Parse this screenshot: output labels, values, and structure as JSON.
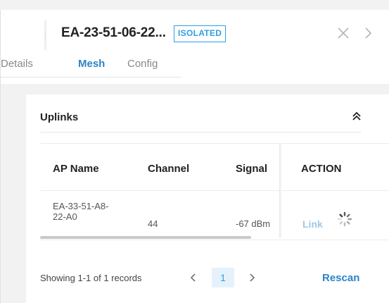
{
  "header": {
    "device_name": "EA-23-51-06-22...",
    "status_badge": "ISOLATED"
  },
  "tabs": [
    {
      "label": "Details",
      "active": false
    },
    {
      "label": "Mesh",
      "active": true
    },
    {
      "label": "Config",
      "active": false
    }
  ],
  "uplinks": {
    "title": "Uplinks",
    "columns": [
      "AP Name",
      "Channel",
      "Signal",
      "ACTION"
    ],
    "rows": [
      {
        "ap_name_line1": "EA-33-51-A8-",
        "ap_name_line2": "22-A0",
        "channel": "44",
        "signal": "-67 dBm",
        "action": "Link"
      }
    ],
    "records_text": "Showing 1-1 of 1 records",
    "current_page": "1",
    "rescan_label": "Rescan"
  },
  "colors": {
    "accent": "#2a84c8",
    "badge": "#2f9fe0",
    "link_disabled": "#9dc9ea"
  },
  "icons": {
    "close": "close-icon",
    "next": "chevron-right-icon",
    "collapse": "double-chevron-up-icon",
    "loading": "spinner-icon"
  }
}
